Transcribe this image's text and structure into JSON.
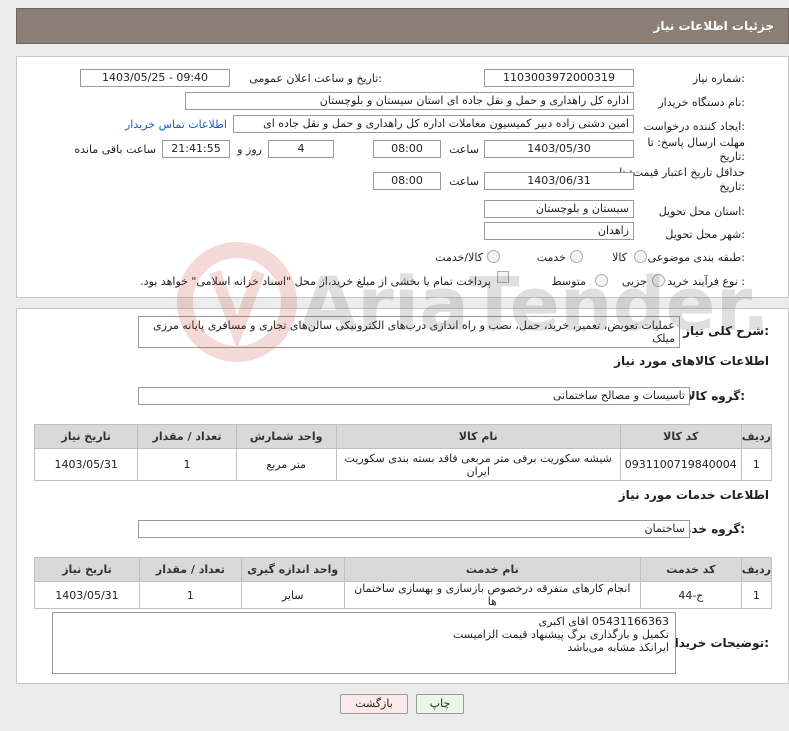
{
  "header": {
    "title": "جزئیات اطلاعات نیاز"
  },
  "fields": {
    "need_number": {
      "label": "شماره نیاز:",
      "value": "1103003972000319"
    },
    "announce_datetime": {
      "label": "تاریخ و ساعت اعلان عمومی:",
      "value": "1403/05/25 - 09:40"
    },
    "buyer_org": {
      "label": "نام دستگاه خریدار:",
      "value": "اداره کل راهداری و حمل و نقل جاده ای استان سیستان و بلوچستان"
    },
    "requester": {
      "label": "ایجاد کننده درخواست:",
      "value": "امین دشتی زاده دبیر کمیسیون معاملات اداره کل راهداری و حمل و نقل جاده ای",
      "contact_link": "اطلاعات تماس خریدار"
    },
    "reply_deadline": {
      "label": "مهلت ارسال پاسخ: تا تاریخ:",
      "date": "1403/05/30",
      "time_label": "ساعت",
      "time": "08:00",
      "days": "4",
      "days_label": "روز و",
      "remaining": "21:41:55",
      "remaining_label": "ساعت باقی مانده"
    },
    "price_validity": {
      "label": "حداقل تاریخ اعتبار قیمت: تا تاریخ:",
      "date": "1403/06/31",
      "time_label": "ساعت",
      "time": "08:00"
    },
    "province": {
      "label": "استان محل تحویل:",
      "value": "سیستان و بلوچستان"
    },
    "city": {
      "label": "شهر محل تحویل:",
      "value": "زاهدان"
    },
    "category": {
      "label": "طبقه بندی موضوعی:",
      "options": [
        "کالا",
        "خدمت",
        "کالا/خدمت"
      ]
    },
    "process_type": {
      "label": "نوع فرآیند خرید :",
      "options": [
        "جزیی",
        "متوسط"
      ],
      "payment_note": "پرداخت تمام یا بخشی از مبلغ خرید،از محل \"اسناد خزانه اسلامی\" خواهد بود."
    }
  },
  "description": {
    "label": "شرح کلی نیاز:",
    "value": "عملیات تعویض، تعمیر، خرید، حمل، نصب و راه اندازی درب‌های الکترونیکی سالن‌های تجاری و مسافری پایانه مرزی میلک"
  },
  "goods": {
    "section_title": "اطلاعات کالاهای مورد نیاز",
    "group_label": "گروه کالا:",
    "group_value": "تاسیسات و مصالح ساختمانی",
    "columns": [
      "ردیف",
      "کد کالا",
      "نام کالا",
      "واحد شمارش",
      "تعداد / مقدار",
      "تاریخ نیاز"
    ],
    "rows": [
      [
        "1",
        "0931100719840004",
        "شیشه سکوریت برفی متر مربعی فاقد بسته بندی سکوریت ایران",
        "متر مربع",
        "1",
        "1403/05/31"
      ]
    ]
  },
  "services": {
    "section_title": "اطلاعات خدمات مورد نیاز",
    "group_label": "گروه خدمت:",
    "group_value": "ساختمان",
    "columns": [
      "ردیف",
      "کد خدمت",
      "نام خدمت",
      "واحد اندازه گیری",
      "تعداد / مقدار",
      "تاریخ نیاز"
    ],
    "rows": [
      [
        "1",
        "ج-44",
        "انجام کارهای متفرقه درخصوص بازسازی و بهسازی ساختمان ها",
        "سایر",
        "1",
        "1403/05/31"
      ]
    ]
  },
  "buyer_notes": {
    "label": "توضیحات خریدار:",
    "value": "05431166363 اقای اکبری\nتکمیل و بارگذاری برگ پیشنهاد قیمت الزامیست\nایرانکد مشابه می‌باشد"
  },
  "buttons": {
    "print": "چاپ",
    "back": "بازگشت"
  },
  "watermark": {
    "text": "AriaTender.net"
  }
}
